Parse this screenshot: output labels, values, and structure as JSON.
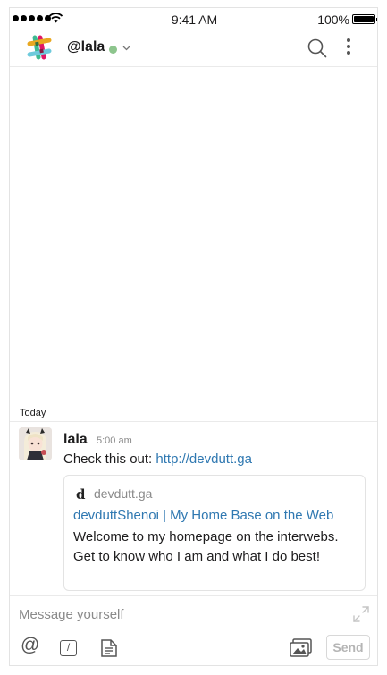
{
  "status_bar": {
    "time": "9:41 AM",
    "battery_percent": "100%",
    "signal_icon": "signal-dots-icon",
    "wifi_icon": "wifi-icon",
    "battery_level": 1.0
  },
  "header": {
    "logo_icon": "slack-logo-icon",
    "channel_name": "@lala",
    "presence_color": "#8dc58d",
    "search_icon": "search-icon",
    "more_icon": "more-vertical-icon"
  },
  "messages": {
    "day_label": "Today",
    "items": [
      {
        "author": "lala",
        "time": "5:00 am",
        "text": "Check this out: ",
        "link": "http://devdutt.ga",
        "unfurl": {
          "site_icon_letter": "d",
          "site_name": "devdutt.ga",
          "title": "devduttShenoi | My Home Base on the Web",
          "description": "Welcome to my homepage on the interwebs. Get to know who I am and what I do best!"
        }
      }
    ]
  },
  "composer": {
    "placeholder": "Message yourself",
    "at_symbol": "@",
    "slash_symbol": "/",
    "send_label": "Send",
    "expand_icon": "expand-icon",
    "file_icon": "snippet-file-icon",
    "image_icon": "image-upload-icon"
  },
  "colors": {
    "link": "#2f78b1",
    "muted": "#8a8a8a",
    "border": "#e3e3e3"
  }
}
